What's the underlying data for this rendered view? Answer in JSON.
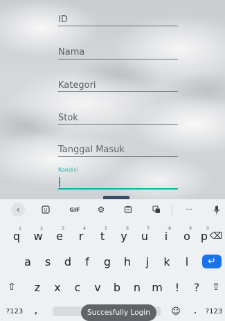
{
  "form": {
    "fields": [
      {
        "placeholder": "ID"
      },
      {
        "placeholder": "Nama"
      },
      {
        "placeholder": "Kategori"
      },
      {
        "placeholder": "Stok"
      },
      {
        "placeholder": "Tanggal Masuk"
      }
    ],
    "active_field": {
      "label": "Kondisi",
      "value": ""
    },
    "accent_color": "#12b3a6"
  },
  "keyboard": {
    "toolbar": {
      "back_icon": "chevron-left-icon",
      "sticker_icon": "sticker-icon",
      "gif_label": "GIF",
      "settings_icon": "gear-icon",
      "clipboard_icon": "clipboard-icon",
      "translate_icon": "translate-icon",
      "more_label": "···",
      "mic_icon": "microphone-icon"
    },
    "row1": [
      {
        "key": "q",
        "hint": "1"
      },
      {
        "key": "w",
        "hint": "2"
      },
      {
        "key": "e",
        "hint": "3"
      },
      {
        "key": "r",
        "hint": "4"
      },
      {
        "key": "t",
        "hint": "5"
      },
      {
        "key": "y",
        "hint": "6"
      },
      {
        "key": "u",
        "hint": "7"
      },
      {
        "key": "i",
        "hint": "8"
      },
      {
        "key": "o",
        "hint": "9"
      },
      {
        "key": "p",
        "hint": "0"
      }
    ],
    "backspace_label": "⌫",
    "row2": [
      "a",
      "s",
      "d",
      "f",
      "g",
      "h",
      "j",
      "k",
      "l"
    ],
    "enter_label": "↵",
    "shift_label": "⇧",
    "row3": [
      "z",
      "x",
      "c",
      "v",
      "b",
      "n",
      "m",
      "!",
      "?"
    ],
    "symbols_label": "?123",
    "comma_label": ",",
    "emoji_label": "☺",
    "period_label": ".",
    "symbols_right_label": "?123",
    "enter_color": "#1a73e8"
  },
  "toast": {
    "message": "Succesfully Login"
  }
}
